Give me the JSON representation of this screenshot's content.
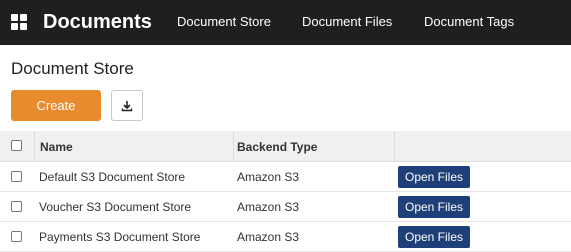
{
  "header": {
    "app_title": "Documents",
    "nav": [
      "Document Store",
      "Document Files",
      "Document Tags"
    ]
  },
  "page": {
    "title": "Document Store",
    "create_label": "Create"
  },
  "table": {
    "columns": [
      "Name",
      "Backend Type"
    ],
    "rows": [
      {
        "name": "Default S3 Document Store",
        "backend": "Amazon S3",
        "action": "Open Files"
      },
      {
        "name": "Voucher S3 Document Store",
        "backend": "Amazon S3",
        "action": "Open Files"
      },
      {
        "name": "Payments S3 Document Store",
        "backend": "Amazon S3",
        "action": "Open Files"
      }
    ]
  },
  "colors": {
    "topbar": "#1f1f1f",
    "create_button": "#e98a2c",
    "open_files_button": "#1f3f78"
  },
  "icons": {
    "app": "grid-icon",
    "download": "download-icon"
  }
}
